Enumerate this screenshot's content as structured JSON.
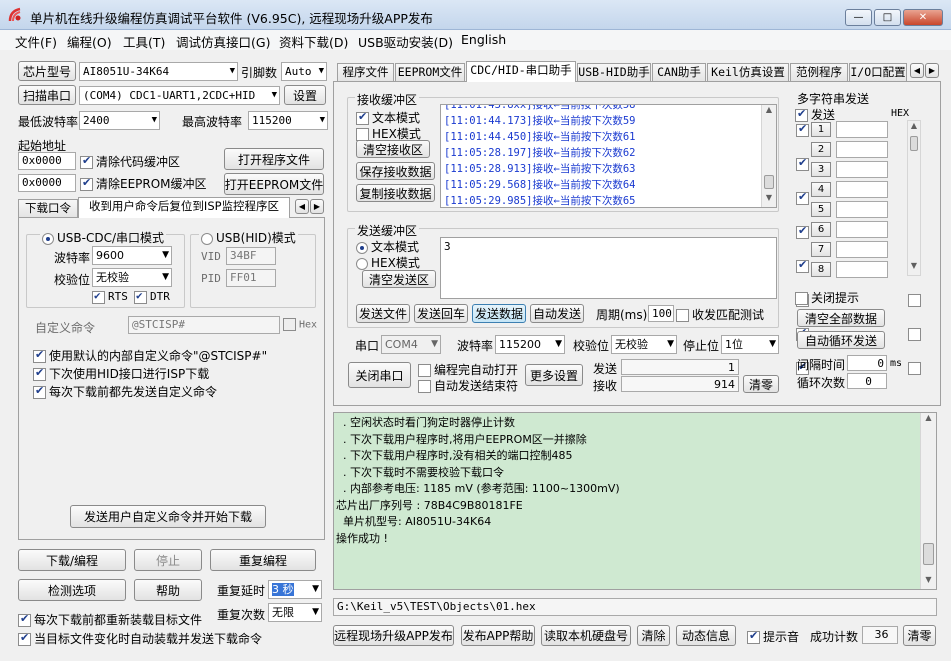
{
  "window": {
    "title": "单片机在线升级编程仿真调试平台软件 (V6.95C), 远程现场升级APP发布",
    "min": "—",
    "max": "□",
    "close": "✕"
  },
  "menu": [
    "文件(F)",
    "编程(O)",
    "工具(T)",
    "调试仿真接口(G)",
    "资料下载(D)",
    "USB驱动安装(D)",
    "English"
  ],
  "left": {
    "chip_btn": "芯片型号",
    "chip_value": "AI8051U-34K64",
    "pin_label": "引脚数",
    "pin_value": "Auto",
    "scan_btn": "扫描串口",
    "port_value": "(COM4) CDC1-UART1,2CDC+HID",
    "settings_btn": "设置",
    "min_baud_label": "最低波特率",
    "min_baud_value": "2400",
    "max_baud_label": "最高波特率",
    "max_baud_value": "115200",
    "start_addr_label": "起始地址",
    "addr1": "0x0000",
    "clear_code": "清除代码缓冲区",
    "open_prog_btn": "打开程序文件",
    "addr2": "0x0000",
    "clear_eeprom": "清除EEPROM缓冲区",
    "open_eeprom_btn": "打开EEPROM文件",
    "tabs": [
      "下载口令",
      "收到用户命令后复位到ISP监控程序区"
    ],
    "usb_cdc_mode": "USB-CDC/串口模式",
    "usb_hid_mode": "USB(HID)模式",
    "baud_label": "波特率",
    "baud_value": "9600",
    "parity_label": "校验位",
    "parity_value": "无校验",
    "rts": "RTS",
    "dtr": "DTR",
    "vid_label": "VID",
    "vid_value": "34BF",
    "pid_label": "PID",
    "pid_value": "FF01",
    "custom_cmd_label": "自定义命令",
    "custom_cmd_value": "@STCISP#",
    "hex_label": "Hex",
    "opt1": "使用默认的内部自定义命令\"@STCISP#\"",
    "opt2": "下次使用HID接口进行ISP下载",
    "opt3": "每次下载前都先发送自定义命令",
    "send_custom_btn": "发送用户自定义命令并开始下载",
    "download_btn": "下载/编程",
    "stop_btn": "停止",
    "reprogram_btn": "重复编程",
    "check_btn": "检测选项",
    "help_btn": "帮助",
    "repeat_delay_label": "重复延时",
    "repeat_delay_value": "3 秒",
    "repeat_count_label": "重复次数",
    "repeat_count_value": "无限",
    "reload_opt": "每次下载前都重新装载目标文件",
    "auto_send_opt": "当目标文件变化时自动装载并发送下载命令"
  },
  "right_tabs": [
    "程序文件",
    "EEPROM文件",
    "CDC/HID-串口助手",
    "USB-HID助手",
    "CAN助手",
    "Keil仿真设置",
    "范例程序",
    "I/O口配置"
  ],
  "serial": {
    "rx_title": "接收缓冲区",
    "text_mode": "文本模式",
    "hex_mode": "HEX模式",
    "clear_rx": "清空接收区",
    "save_rx": "保存接收数据",
    "copy_rx": "复制接收数据",
    "rx_lines": [
      "[11:01:44.173]接收←当前按下次数59",
      "[11:01:44.450]接收←当前按下次数61",
      "[11:05:28.197]接收←当前按下次数62",
      "[11:05:28.913]接收←当前按下次数63",
      "[11:05:29.568]接收←当前按下次数64",
      "[11:05:29.985]接收←当前按下次数65"
    ],
    "tx_title": "发送缓冲区",
    "tx_text": "文本模式",
    "tx_hex": "HEX模式",
    "clear_tx": "清空发送区",
    "tx_value": "3",
    "send_file": "发送文件",
    "send_return": "发送回车",
    "send_data": "发送数据",
    "auto_send": "自动发送",
    "period_label": "周期(ms)",
    "period_value": "100",
    "match_test": "收发匹配测试",
    "port_label": "串口",
    "port_value": "COM4",
    "baud_label": "波特率",
    "baud_value": "115200",
    "parity_label": "校验位",
    "parity_value": "无校验",
    "stop_label": "停止位",
    "stop_value": "1位",
    "close_port": "关闭串口",
    "auto_open": "编程完自动打开",
    "auto_send_end": "自动发送结束符",
    "more_settings": "更多设置",
    "sent_label": "发送",
    "sent_value": "1",
    "recv_label": "接收",
    "recv_value": "914",
    "clear_count": "清零"
  },
  "multi": {
    "title": "多字符串发送",
    "send_label": "发送",
    "hex_label": "HEX",
    "rows": [
      "1",
      "2",
      "3",
      "4",
      "5",
      "6",
      "7",
      "8"
    ],
    "close_tip": "关闭提示",
    "clear_all": "清空全部数据",
    "auto_loop": "自动循环发送",
    "interval_label": "间隔时间",
    "interval_value": "0",
    "interval_unit": "ms",
    "loop_label": "循环次数",
    "loop_value": "0"
  },
  "log": {
    "lines": [
      "  . 空闲状态时看门狗定时器停止计数",
      "  . 下次下载用户程序时,将用户EEPROM区一并擦除",
      "  . 下次下载用户程序时,没有相关的端口控制485",
      "  . 下次下载时不需要校验下载口令",
      "  . 内部参考电压: 1185 mV (参考范围: 1100~1300mV)",
      "芯片出厂序列号 : 78B4C9B80181FE",
      "",
      "  单片机型号: AI8051U-34K64",
      "",
      "操作成功 !"
    ]
  },
  "path": "G:\\Keil_v5\\TEST\\Objects\\01.hex",
  "bottom": {
    "remote_btn": "远程现场升级APP发布",
    "publish_help": "发布APP帮助",
    "read_disk": "读取本机硬盘号",
    "clear_btn": "清除",
    "anim_btn": "动态信息",
    "beep_label": "提示音",
    "success_label": "成功计数",
    "success_value": "36",
    "reset_btn": "清零"
  }
}
